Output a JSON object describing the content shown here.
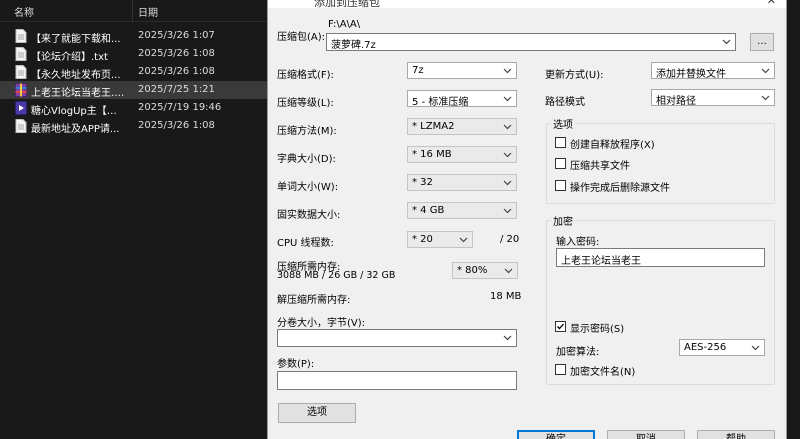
{
  "explorer": {
    "columns": {
      "name": "名称",
      "date": "日期"
    },
    "files": [
      {
        "name": "【来了就能下载和...",
        "date": "2025/3/26 1:07",
        "icon": "text-file-icon"
      },
      {
        "name": "【论坛介绍】.txt",
        "date": "2025/3/26 1:08",
        "icon": "text-file-icon"
      },
      {
        "name": "【永久地址发布页...",
        "date": "2025/3/26 1:08",
        "icon": "text-file-icon"
      },
      {
        "name": "上老王论坛当老王.z...",
        "date": "2025/7/25 1:21",
        "icon": "archive-file-icon"
      },
      {
        "name": "糖心VlogUp主【菠...",
        "date": "2025/7/19 19:46",
        "icon": "video-file-icon"
      },
      {
        "name": "最新地址及APP请...",
        "date": "2025/3/26 1:08",
        "icon": "text-file-icon"
      }
    ]
  },
  "dialog": {
    "title": "添加到压缩包",
    "archive": {
      "label": "压缩包(A):",
      "path": "F:\\A\\A\\",
      "filename": "菠萝碑.7z",
      "browse_label": "..."
    },
    "left": {
      "format": {
        "label": "压缩格式(F):",
        "value": "7z"
      },
      "level": {
        "label": "压缩等级(L):",
        "value": "5 - 标准压缩"
      },
      "method": {
        "label": "压缩方法(M):",
        "value": "* LZMA2"
      },
      "dict": {
        "label": "字典大小(D):",
        "value": "* 16 MB"
      },
      "word": {
        "label": "单词大小(W):",
        "value": "* 32"
      },
      "solid": {
        "label": "固实数据大小:",
        "value": "* 4 GB"
      },
      "cpu": {
        "label": "CPU 线程数:",
        "value": "* 20",
        "total": "/ 20"
      },
      "mem": {
        "label": "压缩所需内存:",
        "detail": "3088 MB / 26 GB / 32 GB",
        "value": "* 80%"
      },
      "decomp": {
        "label": "解压缩所需内存:",
        "value": "18 MB"
      },
      "volume": {
        "label": "分卷大小，字节(V):",
        "value": ""
      },
      "params": {
        "label": "参数(P):",
        "value": ""
      },
      "options_button": "选项"
    },
    "right": {
      "update": {
        "label": "更新方式(U):",
        "value": "添加并替换文件"
      },
      "pathmode": {
        "label": "路径模式",
        "value": "相对路径"
      },
      "options_group": {
        "title": "选项",
        "items": [
          {
            "label": "创建自释放程序(X)",
            "checked": false
          },
          {
            "label": "压缩共享文件",
            "checked": false
          },
          {
            "label": "操作完成后删除源文件",
            "checked": false
          }
        ]
      },
      "encryption": {
        "title": "加密",
        "password_label": "输入密码:",
        "password_value": "上老王论坛当老王",
        "show_password_label": "显示密码(S)",
        "show_password_checked": true,
        "method_label": "加密算法:",
        "method_value": "AES-256",
        "encrypt_names_label": "加密文件名(N)",
        "encrypt_names_checked": false
      }
    },
    "buttons": {
      "ok": "确定",
      "cancel": "取消",
      "help": "帮助"
    }
  }
}
